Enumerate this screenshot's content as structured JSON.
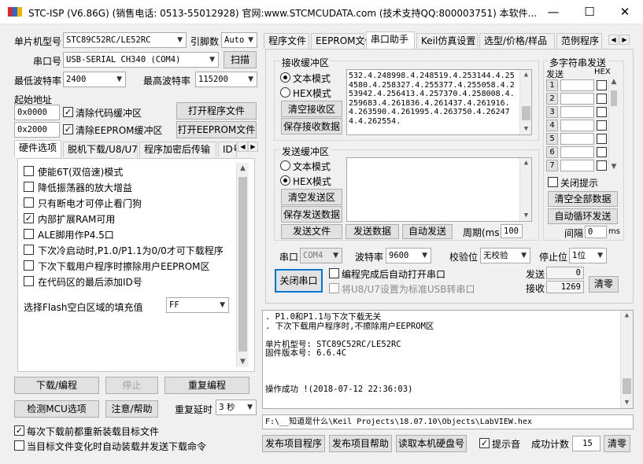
{
  "window": {
    "title": "STC-ISP (V6.86G) (销售电话: 0513-55012928) 官网:www.STCMCUDATA.com  (技术支持QQ:800003751) 本软件...",
    "minimize": "—",
    "maximize": "☐",
    "close": "✕"
  },
  "left": {
    "mcu_type_label": "单片机型号",
    "mcu_type_value": "STC89C52RC/LE52RC",
    "pin_count_label": "引脚数",
    "pin_count_value": "Auto",
    "port_label": "串口号",
    "port_value": "USB-SERIAL CH340 (COM4)",
    "scan_button": "扫描",
    "min_baud_label": "最低波特率",
    "min_baud_value": "2400",
    "max_baud_label": "最高波特率",
    "max_baud_value": "115200",
    "start_addr_label": "起始地址",
    "code_addr": "0x0000",
    "clear_code_label": "清除代码缓冲区",
    "open_program_button": "打开程序文件",
    "eeprom_addr": "0x2000",
    "clear_eeprom_label": "清除EEPROM缓冲区",
    "open_eeprom_button": "打开EEPROM文件",
    "tabs": [
      "硬件选项",
      "脱机下载/U8/U7",
      "程序加密后传输",
      "ID号"
    ],
    "options": [
      {
        "label": "使能6T(双倍速)模式",
        "checked": false
      },
      {
        "label": "降低振荡器的放大增益",
        "checked": false
      },
      {
        "label": "只有断电才可停止看门狗",
        "checked": false
      },
      {
        "label": "内部扩展RAM可用",
        "checked": true
      },
      {
        "label": "ALE脚用作P4.5口",
        "checked": false
      },
      {
        "label": "下次冷启动时,P1.0/P1.1为0/0才可下载程序",
        "checked": false
      },
      {
        "label": "下次下载用户程序时擦除用户EEPROM区",
        "checked": false
      },
      {
        "label": "在代码区的最后添加ID号",
        "checked": false
      }
    ],
    "fill_label": "选择Flash空白区域的填充值",
    "fill_value": "FF",
    "download_button": "下载/编程",
    "stop_button": "停止",
    "reprogram_button": "重复编程",
    "detect_button": "检测MCU选项",
    "help_button": "注意/帮助",
    "retry_delay_label": "重复延时",
    "retry_delay_value": "3 秒",
    "reload_label": "每次下载前都重新装载目标文件",
    "autoload_label": "当目标文件变化时自动装载并发送下载命令"
  },
  "right": {
    "tabs": [
      "程序文件",
      "EEPROM文件",
      "串口助手",
      "Keil仿真设置",
      "选型/价格/样品",
      "范例程序"
    ],
    "recv_group": "接收缓冲区",
    "text_mode": "文本模式",
    "hex_mode": "HEX模式",
    "clear_recv_button": "清空接收区",
    "save_recv_button": "保存接收数据",
    "recv_text": "532.4.248998.4.248519.4.253144.4.254580.4.258327.4.255377.4.255058.4.253942.4.256413.4.257370.4.258008.4.259683.4.261836.4.261437.4.261916.4.263590.4.261995.4.263750.4.262474.4.262554.",
    "send_group": "发送缓冲区",
    "send_text_mode": "文本模式",
    "send_hex_mode": "HEX模式",
    "clear_send_button": "清空发送区",
    "save_send_button": "保存发送数据",
    "send_file_button": "发送文件",
    "send_data_button": "发送数据",
    "auto_send_button": "自动发送",
    "period_label": "周期(ms)",
    "period_value": "100",
    "multi_group": "多字符串发送",
    "multi_send_header": "发送",
    "multi_hex_header": "HEX",
    "multi_rows": [
      "1",
      "2",
      "3",
      "4",
      "5",
      "6",
      "7"
    ],
    "close_hint_label": "关闭提示",
    "clear_all_button": "清空全部数据",
    "auto_loop_button": "自动循环发送",
    "interval_label": "间隔",
    "interval_value": "0",
    "interval_unit": "ms",
    "port_label": "串口",
    "port_value": "COM4",
    "baud_label": "波特率",
    "baud_value": "9600",
    "parity_label": "校验位",
    "parity_value": "无校验",
    "stop_label": "停止位",
    "stop_value": "1位",
    "close_port_button": "关闭串口",
    "open_after_prog_label": "编程完成后自动打开串口",
    "set_usb_label": "将U8/U7设置为标准USB转串口",
    "sent_label": "发送",
    "sent_value": "0",
    "recv_label": "接收",
    "recv_value": "1269",
    "clear_counter_button": "清零",
    "log_lines": [
      ". P1.0和P1.1与下次下载无关",
      ". 下次下载用户程序时,不擦除用户EEPROM区",
      "",
      "单片机型号: STC89C52RC/LE52RC",
      "固件版本号: 6.6.4C",
      "",
      "",
      "",
      "操作成功 !(2018-07-12 22:36:03)"
    ],
    "file_path": "F:\\__知道是什么\\Keil Projects\\18.07.10\\Objects\\LabVIEW.hex",
    "publish_button": "发布项目程序",
    "publish_help_button": "发布项目帮助",
    "read_disk_button": "读取本机硬盘号",
    "beep_label": "提示音",
    "success_count_label": "成功计数",
    "success_count_value": "15",
    "clear_success_button": "清零"
  }
}
